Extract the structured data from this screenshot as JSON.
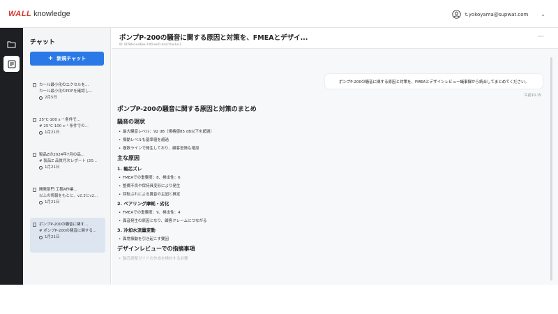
{
  "header": {
    "logo_mark": "WALL",
    "logo_text": "knowledge",
    "user_email": "t.yokoyama@supwat.com",
    "chevron": "⌄"
  },
  "rail": {
    "items": [
      {
        "icon": "folder-icon",
        "active": false
      },
      {
        "icon": "chat-icon",
        "active": true
      }
    ]
  },
  "sidebar": {
    "title": "チャット",
    "new_chat_label": "新規チャット",
    "new_chat_icon": "+",
    "chats": [
      {
        "title": "カール最小化のエクセルを...",
        "preview": "カール最小化のPDFを確認し...",
        "date": "2月5日"
      },
      {
        "title": "25°C·100 s⁻¹ 条件で...",
        "preview": "# 25°C·100 s⁻¹ 条件での...",
        "date": "1月21日"
      },
      {
        "title": "製品Zの2024年7月の品...",
        "preview": "# 製品Z 品質月次レポート (20...",
        "date": "1月21日"
      },
      {
        "title": "開発部門 工程A作業...",
        "preview": "以上の情報をもとに、v2.3とv2...",
        "date": "1月21日"
      },
      {
        "title": "ポンプP-200の騒音に関す...",
        "preview": "# ポンプP-200の騒音に関する...",
        "date": "1月21日"
      }
    ]
  },
  "main": {
    "title": "ポンプP-200の騒音に関する原因と対策を、FMEAとデザイ...",
    "id_text": "ID: 01f8de1e-b6ee-74f0-ae01-4a1cf1ae1ac1",
    "more": "···",
    "user_message": "ポンプP-200の騒音に関する原因と対策を、FMEAとデザインレビュー議事録から統合してまとめてください。",
    "message_time": "午前10:15",
    "answer": {
      "heading": "ポンプP-200の騒音に関する原因と対策のまとめ",
      "s1_title": "騒音の現状",
      "s1_items": [
        "最大騒音レベル：92 dB（規格値85 dB以下を超過）",
        "振動レベルも基準値を超過",
        "複数ラインで発生しており、顧客苦情も増加"
      ],
      "s2_title": "主な原因",
      "c1_title": "1. 軸芯ズレ",
      "c1_items": [
        "FMEAでの重要度：8、検出性：6",
        "整備不良や保持具変形により発生",
        "回転ぶれによる異音の主因と推定"
      ],
      "c2_title": "2. ベアリング摩耗・劣化",
      "c2_items": [
        "FMEAでの重要度：9、検出性：4",
        "異音発生の原因となり、顧客クレームにつながる"
      ],
      "c3_title": "3. 冷却水流量変動",
      "c3_items": [
        "異常振動を引き起こす要因"
      ],
      "s3_title": "デザインレビューでの指摘事項",
      "s3_items": [
        "軸芯調整ガイドの作成を検討する必要"
      ]
    }
  },
  "colors": {
    "accent": "#2b79e6",
    "brand_red": "#d6332b",
    "rail": "#1e1f23"
  }
}
